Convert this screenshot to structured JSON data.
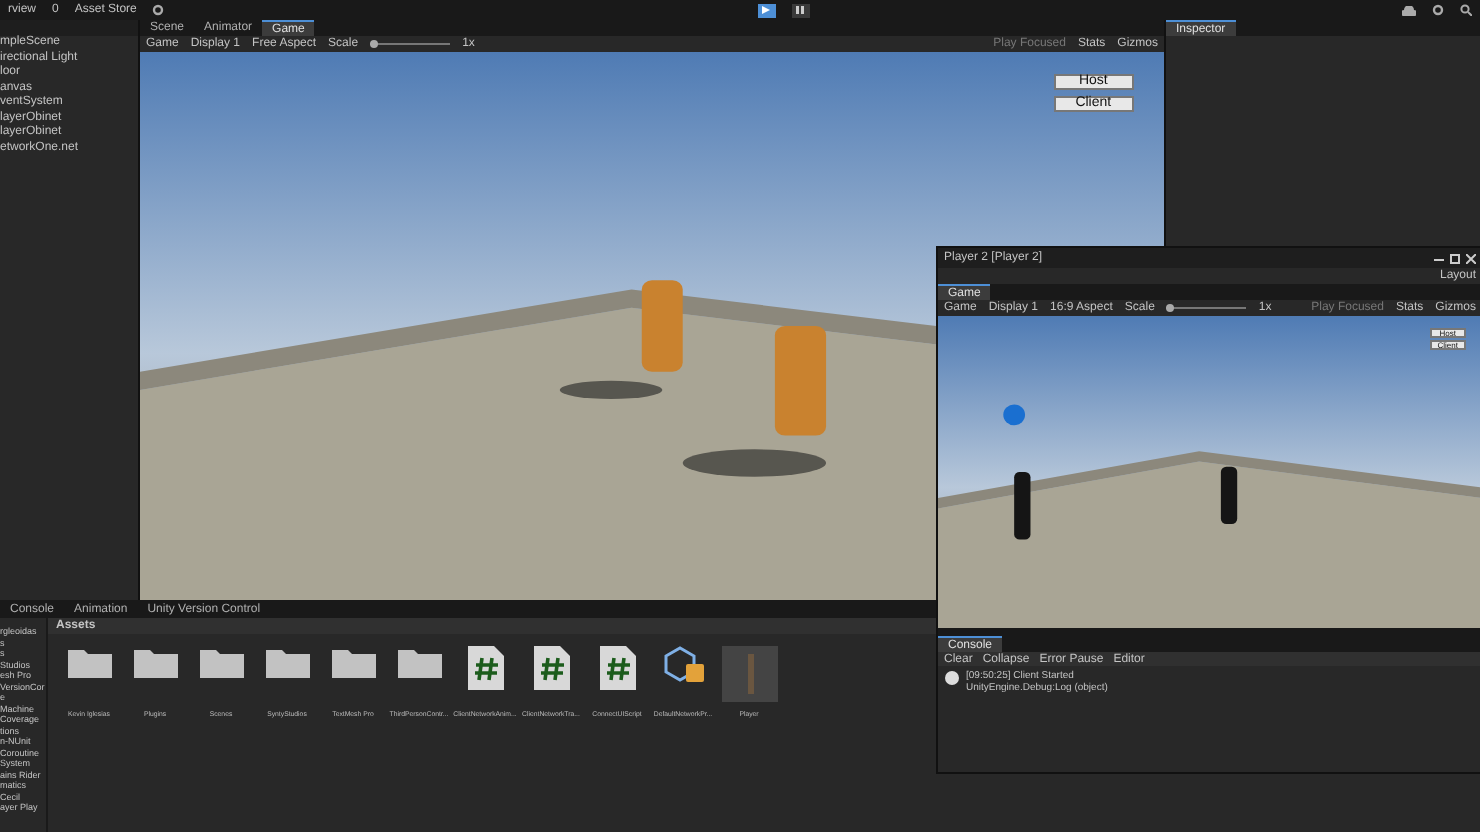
{
  "toolbar": {
    "title": "rview",
    "account": "0",
    "store": "Asset Store"
  },
  "hierarchy": {
    "items": [
      "mpleScene",
      "irectional Light",
      "loor",
      "anvas",
      "ventSystem",
      "layerObinet",
      "layerObinet",
      "etworkOne.net"
    ]
  },
  "scene_tabs": [
    {
      "label": "Scene",
      "selected": false
    },
    {
      "label": "Animator",
      "selected": false
    },
    {
      "label": "Game",
      "selected": true
    }
  ],
  "game_toolbar": {
    "mode": "Game",
    "display": "Display 1",
    "aspect": "Free Aspect",
    "scale_label": "Scale",
    "scale_slider": {
      "level": 0
    },
    "scale_value": "1x",
    "play_mode": "Play Focused",
    "stats": "Stats",
    "gizmos": "Gizmos"
  },
  "game_buttons": [
    "Host",
    "Client"
  ],
  "inspector": {
    "tab": "Inspector"
  },
  "bottom_tabs": [
    {
      "label": "Console",
      "selected": false
    },
    {
      "label": "Animation",
      "selected": false
    },
    {
      "label": "Unity Version Control",
      "selected": false
    }
  ],
  "project": {
    "breadcrumb": "Assets",
    "sidebar": [
      "rgleoidas",
      "s",
      "s",
      "Studios",
      "esh Pro",
      "VersionCor",
      "e",
      "Machine",
      "Coverage",
      "tions",
      "n-NUnit",
      "Coroutine",
      "System",
      "ains Rider",
      "matics",
      "Cecil",
      "ayer Play"
    ],
    "assets": [
      {
        "kind": "folder",
        "name": "Kevin Iglesias"
      },
      {
        "kind": "folder",
        "name": "Plugins"
      },
      {
        "kind": "folder",
        "name": "Scenes"
      },
      {
        "kind": "folder",
        "name": "SyntyStudios"
      },
      {
        "kind": "folder",
        "name": "TextMesh Pro"
      },
      {
        "kind": "folder",
        "name": "ThirdPersonContr..."
      },
      {
        "kind": "script",
        "name": "ClientNetworkAnim..."
      },
      {
        "kind": "script",
        "name": "ClientNetworkTra..."
      },
      {
        "kind": "script",
        "name": "ConnectUIScript"
      },
      {
        "kind": "prefab",
        "name": "DefaultNetworkPr..."
      },
      {
        "kind": "model",
        "name": "Player"
      }
    ]
  },
  "player_window": {
    "title": "Player 2 [Player 2]",
    "layout": "Layout",
    "tab": "Game",
    "toolbar": {
      "mode": "Game",
      "display": "Display 1",
      "aspect": "16:9 Aspect",
      "scale_label": "Scale",
      "scale_slider": {
        "level": 0
      },
      "scale_value": "1x",
      "play_mode": "Play Focused",
      "stats": "Stats",
      "gizmos": "Gizmos"
    },
    "buttons": [
      "Host",
      "Client"
    ],
    "console": {
      "tab": "Console",
      "buttons": [
        "Clear",
        "Collapse",
        "Error Pause",
        "Editor"
      ],
      "log": {
        "line1": "[09:50:25] Client Started",
        "line2": "UnityEngine.Debug:Log (object)"
      }
    }
  }
}
